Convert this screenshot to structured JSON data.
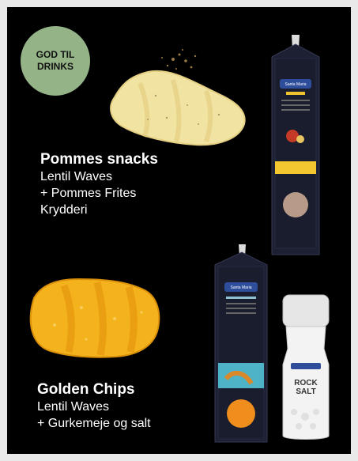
{
  "badge": {
    "line1": "GOD TIL",
    "line2": "DRINKS"
  },
  "products": [
    {
      "title": "Pommes snacks",
      "lines": [
        "Lentil Waves",
        "+ Pommes Frites",
        "Krydderi"
      ]
    },
    {
      "title": "Golden Chips",
      "lines": [
        "Lentil Waves",
        "+ Gurkemeje og salt"
      ]
    }
  ],
  "packaging": {
    "brand_top": "Santa Maria",
    "brand_bottom": "Santa Maria",
    "grinder_line1": "ROCK",
    "grinder_line2": "SALT"
  },
  "colors": {
    "background": "#000000",
    "badge": "#94b487",
    "text": "#ffffff",
    "snack_light": "#f1e3a2",
    "snack_gold": "#f4b31c"
  }
}
